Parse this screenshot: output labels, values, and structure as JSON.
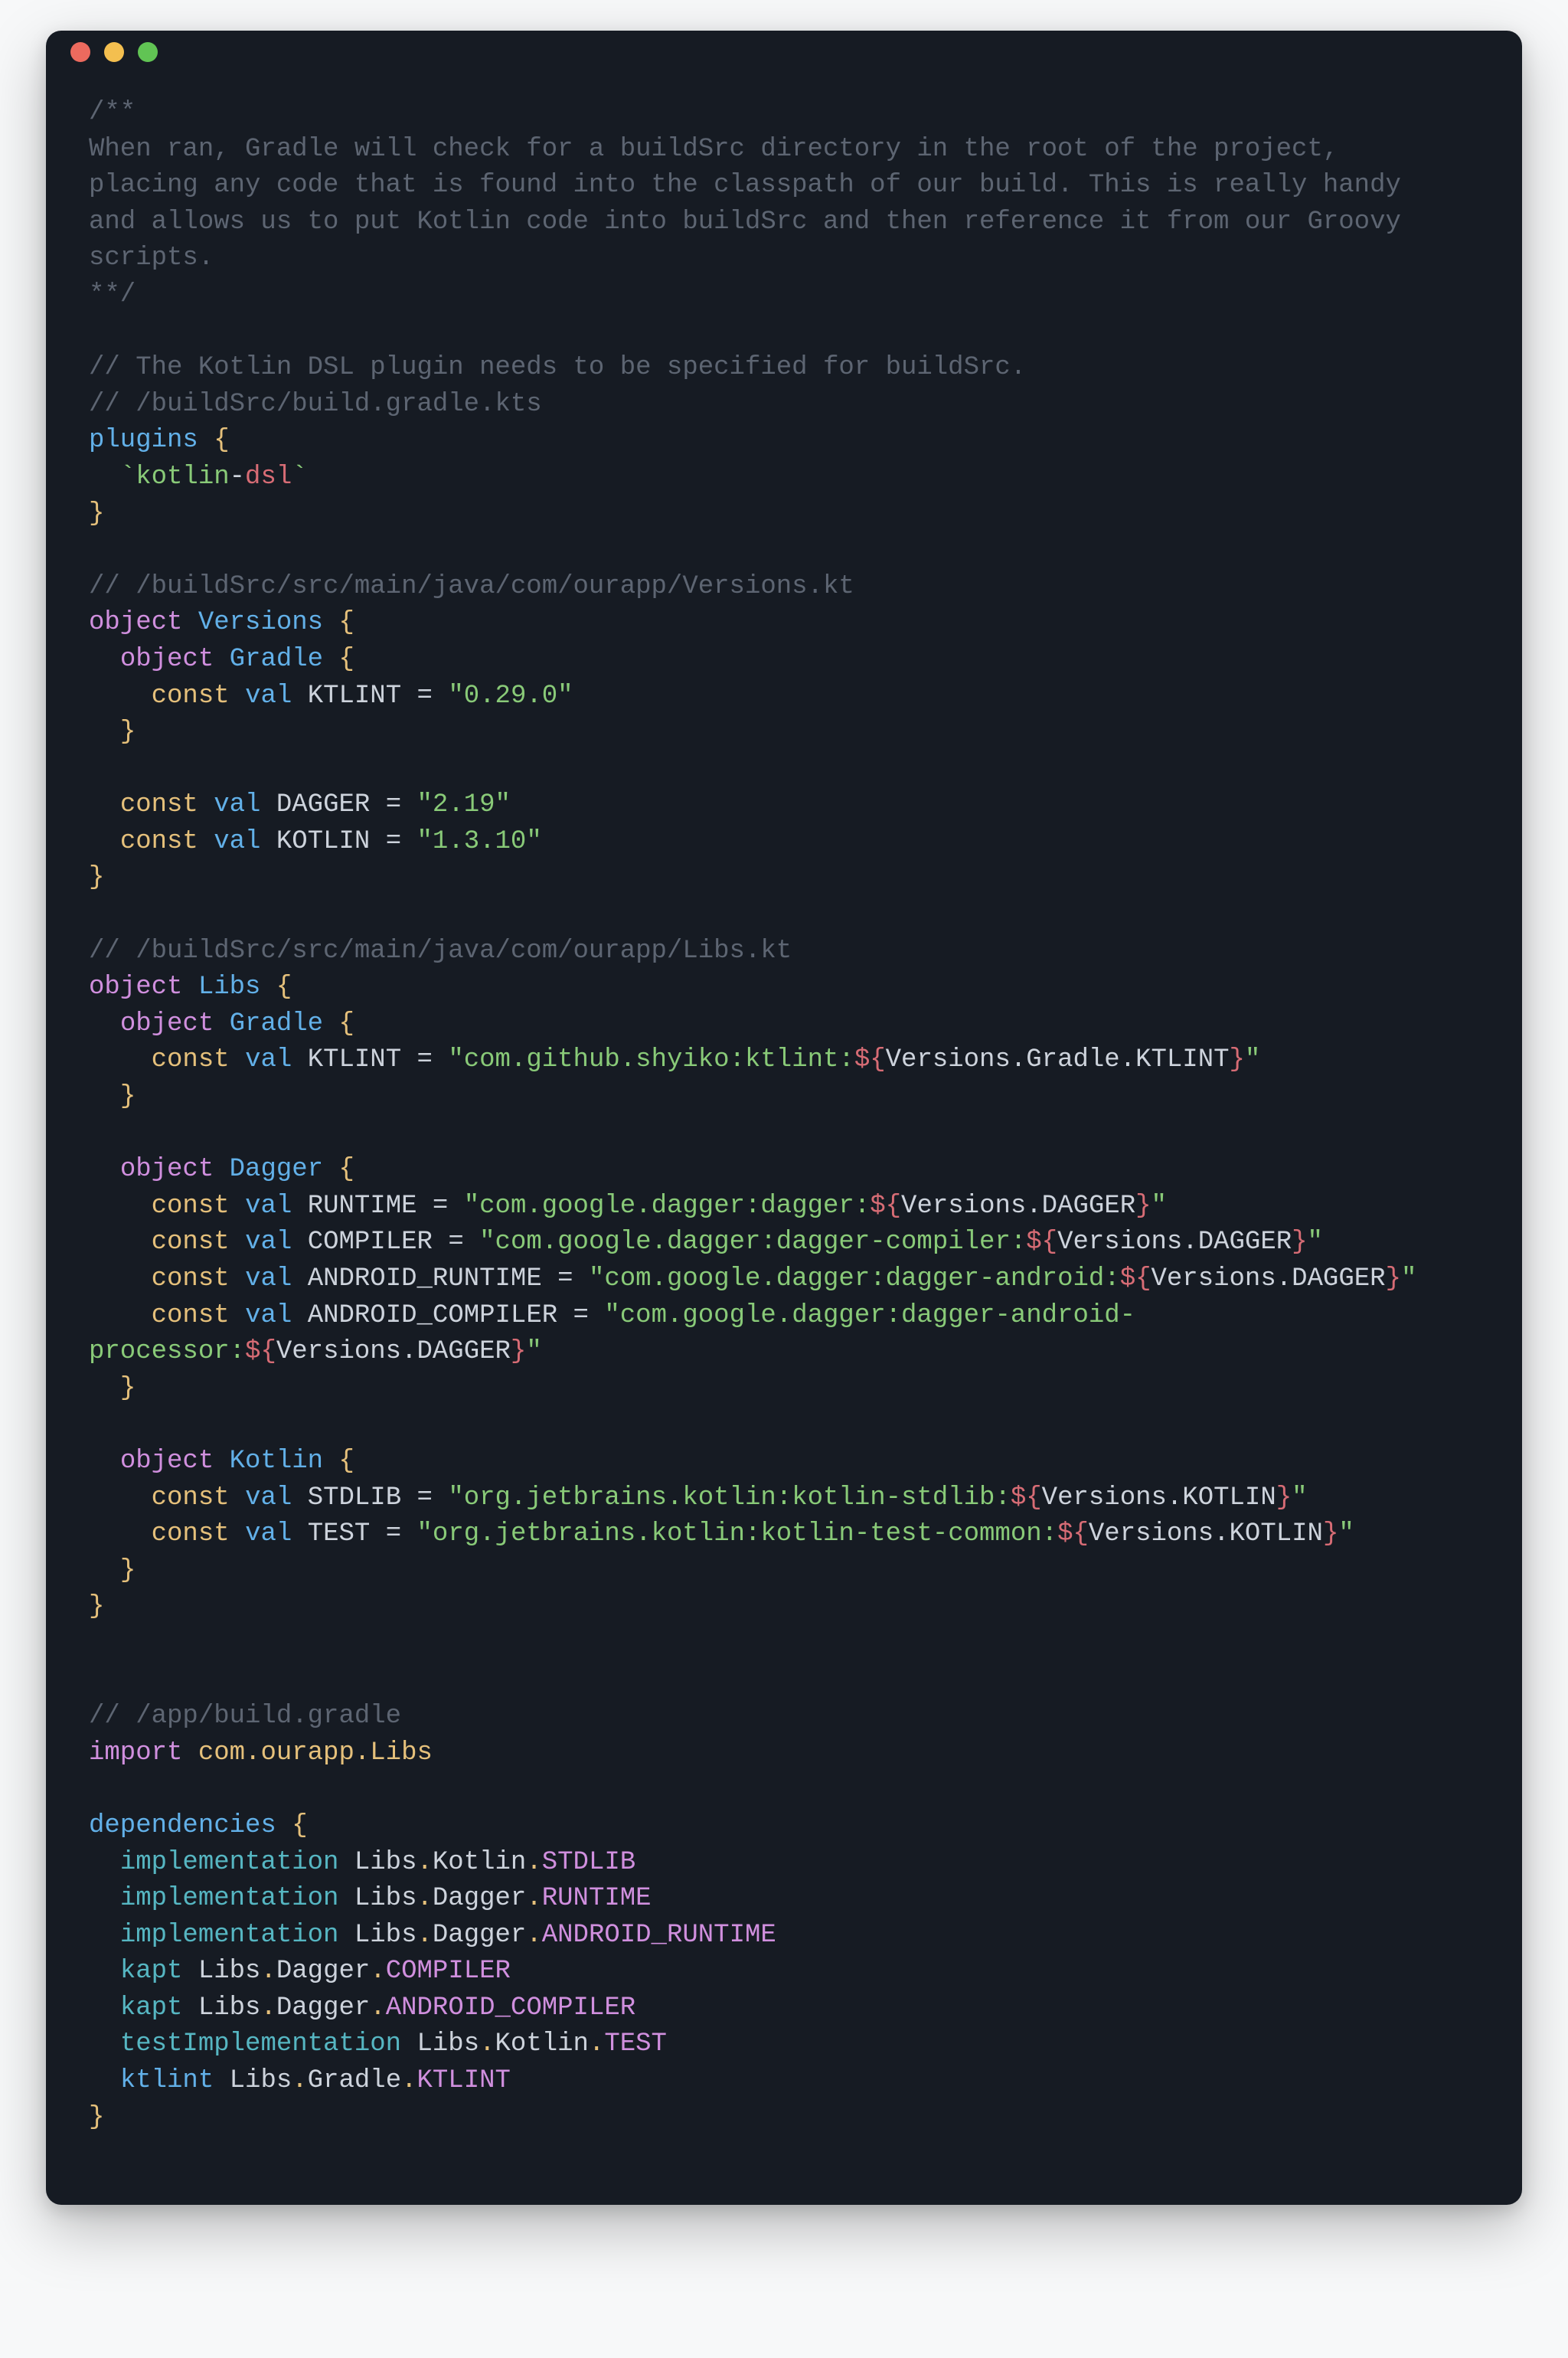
{
  "c_block_start": "/**",
  "c_block_l1": "When ran, Gradle will check for a buildSrc directory in the root of the project, ",
  "c_block_l2": "placing any code that is found into the classpath of our build. This is really handy ",
  "c_block_l3": "and allows us to put Kotlin code into buildSrc and then reference it from our Groovy ",
  "c_block_l4": "scripts.",
  "c_block_end": "**/",
  "c_dsl_note": "// The Kotlin DSL plugin needs to be specified for buildSrc.",
  "c_buildSrc_gradle": "// /buildSrc/build.gradle.kts",
  "plugins_kw": "plugins",
  "backtick1": "`",
  "kotlin_txt": "kotlin",
  "dash": "-",
  "dsl_txt": "dsl",
  "backtick2": "`",
  "c_versions_path": "// /buildSrc/src/main/java/com/ourapp/Versions.kt",
  "kw_object": "object",
  "name_Versions": "Versions",
  "name_Gradle": "Gradle",
  "kw_const": "const",
  "kw_val": "val",
  "name_KTLINT": "KTLINT",
  "eq": "=",
  "v_ktlint": "\"0.29.0\"",
  "name_DAGGER": "DAGGER",
  "v_dagger": "\"2.19\"",
  "name_KOTLIN": "KOTLIN",
  "v_kotlin": "\"1.3.10\"",
  "c_libs_path": "// /buildSrc/src/main/java/com/ourapp/Libs.kt",
  "name_Libs": "Libs",
  "s_lib_ktlint_a": "\"com.github.shyiko:ktlint:",
  "intp_open": "${",
  "intp_close": "}",
  "path_V_G_KTLINT": "Versions.Gradle.KTLINT",
  "s_close": "\"",
  "name_Dagger": "Dagger",
  "name_RUNTIME": "RUNTIME",
  "s_dagger_runtime_a": "\"com.google.dagger:dagger:",
  "path_V_DAGGER": "Versions.DAGGER",
  "name_COMPILER": "COMPILER",
  "s_dagger_compiler_a": "\"com.google.dagger:dagger-compiler:",
  "name_ANDROID_RUNTIME": "ANDROID_RUNTIME",
  "s_dagger_android_rt_a": "\"com.google.dagger:dagger-android:",
  "name_ANDROID_COMPILER": "ANDROID_COMPILER",
  "s_dagger_android_comp_a": "\"com.google.dagger:dagger-android-processor:",
  "name_Kotlin": "Kotlin",
  "name_STDLIB": "STDLIB",
  "s_kotlin_stdlib_a": "\"org.jetbrains.kotlin:kotlin-stdlib:",
  "path_V_KOTLIN": "Versions.KOTLIN",
  "name_TEST": "TEST",
  "s_kotlin_test_a": "\"org.jetbrains.kotlin:kotlin-test-common:",
  "c_app_gradle": "// /app/build.gradle",
  "kw_import": "import",
  "import_pkg": "com.ourapp.Libs",
  "kw_dependencies": "dependencies",
  "cfg_implementation": "implementation",
  "cfg_kapt": "kapt",
  "cfg_testImplementation": "testImplementation",
  "cfg_ktlint": "ktlint",
  "p_Libs": "Libs",
  "p_Kotlin": "Kotlin",
  "p_STDLIB": "STDLIB",
  "p_Dagger": "Dagger",
  "p_RUNTIME": "RUNTIME",
  "p_ANDROID_RUNTIME": "ANDROID_RUNTIME",
  "p_COMPILER": "COMPILER",
  "p_ANDROID_COMPILER": "ANDROID_COMPILER",
  "p_TEST": "TEST",
  "p_Gradle": "Gradle",
  "p_KTLINT": "KTLINT",
  "brace_open": "{",
  "brace_close": "}",
  "dot": "."
}
